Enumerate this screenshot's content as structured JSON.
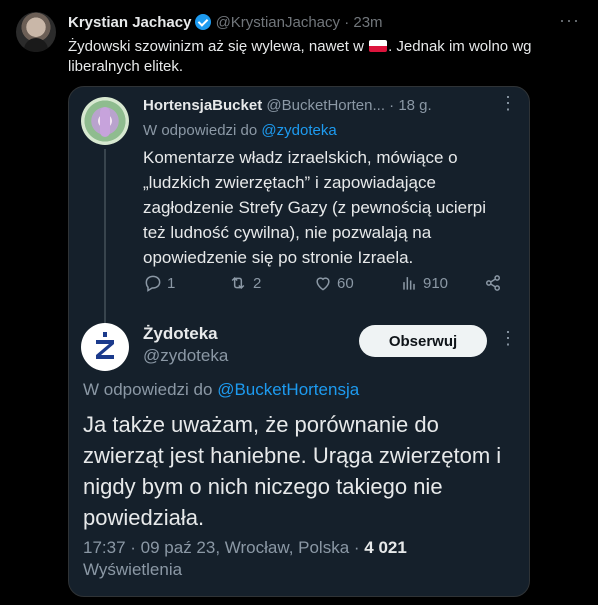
{
  "tweet": {
    "author_name": "Krystian Jachacy",
    "handle": "@KrystianJachacy",
    "separator": "·",
    "time": "23m",
    "text_before_flag": "Żydowski szowinizm aż się wylewa, nawet w ",
    "text_after_flag": ". Jednak im wolno wg liberalnych elitek.",
    "more_label": "···"
  },
  "quoted": {
    "reply": {
      "author_name": "HortensjaBucket",
      "handle": "@BucketHorten...",
      "separator": "·",
      "time": "18 g.",
      "more_label": "⋮",
      "reply_prefix": "W odpowiedzi do ",
      "reply_to": "@zydoteka",
      "body": "Komentarze władz izraelskich, mówiące o „ludzkich zwierzętach” i zapowiadające zagłodzenie Strefy Gazy (z pewnością ucierpi też ludność cywilna), nie pozwalają na opowiedzenie się po stronie Izraela.",
      "stats": {
        "replies": "1",
        "reposts": "2",
        "likes": "60",
        "views": "910"
      }
    },
    "main": {
      "author_name": "Żydoteka",
      "handle": "@zydoteka",
      "follow_label": "Obserwuj",
      "more_label": "⋮",
      "reply_prefix": "W odpowiedzi do ",
      "reply_to": "@BucketHortensja",
      "body": "Ja także uważam, że porównanie do zwierząt jest haniebne. Urąga zwierzętom i nigdy bym o nich niczego takiego nie powiedziała.",
      "timestamp": "17:37 · 09 paź 23, Wrocław, Polska · ",
      "views_count": "4 021",
      "views_label": "Wyświetlenia"
    }
  },
  "colors": {
    "accent": "#1d9bf0",
    "card_bg": "#15202b",
    "page_bg": "#000000"
  }
}
